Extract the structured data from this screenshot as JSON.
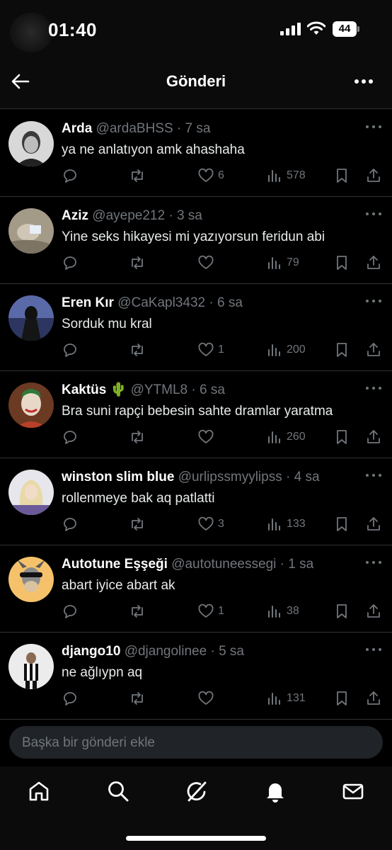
{
  "status_bar": {
    "time": "01:40",
    "battery": "44"
  },
  "header": {
    "title": "Gönderi",
    "back_icon": "arrow-left-icon",
    "more_icon": "more-horizontal-icon"
  },
  "replies": [
    {
      "name": "Arda",
      "handle": "@ardaBHSS",
      "time": "7 sa",
      "text": "ya ne anlatıyon amk ahashaha",
      "likes": "6",
      "views": "578",
      "avatar_color": "#8a8a8a"
    },
    {
      "name": "Aziz",
      "handle": "@ayepe212",
      "time": "3 sa",
      "text": "Yine seks hikayesi mi yazıyorsun feridun abi",
      "likes": "",
      "views": "79",
      "avatar_color": "#9a8f7e"
    },
    {
      "name": "Eren Kır",
      "handle": "@CaKapl3432",
      "time": "6 sa",
      "text": "Sorduk mu kral",
      "likes": "1",
      "views": "200",
      "avatar_color": "#3a4a7a"
    },
    {
      "name": "Kaktüs 🌵",
      "handle": "@YTML8",
      "time": "6 sa",
      "text": "Bra suni rapçi bebesin sahte dramlar yaratma",
      "likes": "",
      "views": "260",
      "avatar_color": "#5a3a2a"
    },
    {
      "name": "winston slim blue",
      "handle": "@urlipssmyylipss",
      "time": "4 sa",
      "text": "rollenmeye bak aq patlatti",
      "likes": "3",
      "views": "133",
      "avatar_color": "#d9d9e0"
    },
    {
      "name": "Autotune Eşşeği",
      "handle": "@autotuneessegi",
      "time": "1 sa",
      "text": "abart iyice abart ak",
      "likes": "1",
      "views": "38",
      "avatar_color": "#f5c26b"
    },
    {
      "name": "django10",
      "handle": "@djangolinee",
      "time": "5 sa",
      "text": "ne ağlıypn aq",
      "likes": "",
      "views": "131",
      "avatar_color": "#e8e8e8"
    }
  ],
  "composer": {
    "placeholder": "Başka bir gönderi ekle"
  },
  "nav": [
    "home-icon",
    "search-icon",
    "grok-icon",
    "notifications-icon",
    "messages-icon"
  ],
  "colors": {
    "background": "#000000",
    "text": "#e7e9ea",
    "muted": "#71767b",
    "divider": "#2f3336"
  }
}
